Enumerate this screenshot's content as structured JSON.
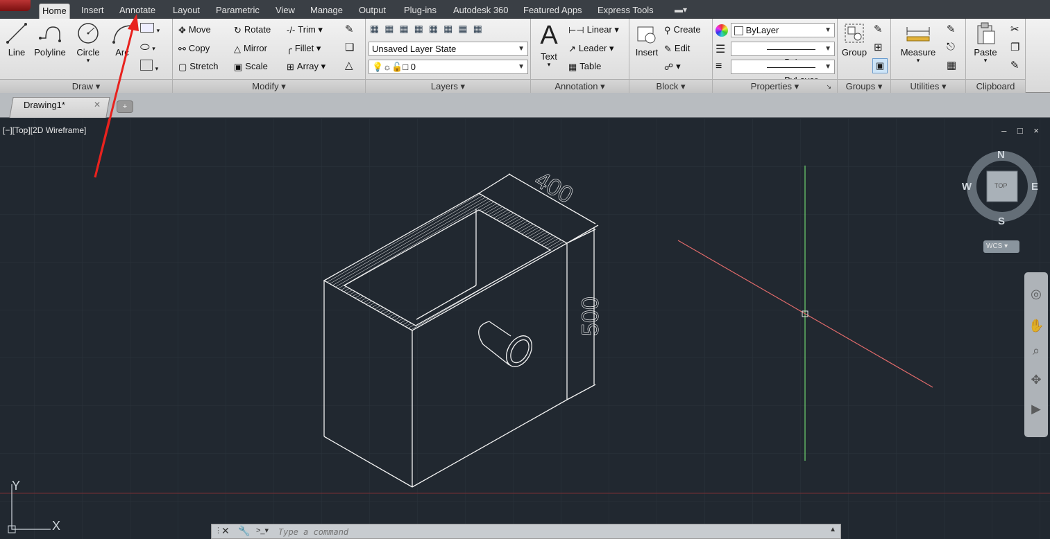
{
  "ribbon_tabs": [
    "Home",
    "Insert",
    "Annotate",
    "Layout",
    "Parametric",
    "View",
    "Manage",
    "Output",
    "Plug-ins",
    "Autodesk 360",
    "Featured Apps",
    "Express Tools"
  ],
  "active_tab": "Home",
  "draw": {
    "title": "Draw",
    "line": "Line",
    "polyline": "Polyline",
    "circle": "Circle",
    "arc": "Arc"
  },
  "modify": {
    "title": "Modify",
    "move": "Move",
    "rotate": "Rotate",
    "trim": "Trim",
    "copy": "Copy",
    "mirror": "Mirror",
    "fillet": "Fillet",
    "stretch": "Stretch",
    "scale": "Scale",
    "array": "Array"
  },
  "layers": {
    "title": "Layers",
    "layer_state": "Unsaved Layer State",
    "current_layer": "0"
  },
  "annotation": {
    "title": "Annotation",
    "text": "Text",
    "linear": "Linear",
    "leader": "Leader",
    "table": "Table"
  },
  "block": {
    "title": "Block",
    "insert": "Insert",
    "create": "Create",
    "edit": "Edit"
  },
  "properties": {
    "title": "Properties",
    "color": "ByLayer",
    "linetype": "ByLayer",
    "lineweight": "ByLayer"
  },
  "groups": {
    "title": "Groups",
    "group": "Group"
  },
  "utilities": {
    "title": "Utilities",
    "measure": "Measure"
  },
  "clipboard": {
    "title": "Clipboard",
    "paste": "Paste"
  },
  "document_tab": "Drawing1*",
  "viewport_label": "[−][Top][2D Wireframe]",
  "viewport_controls": "– □ ×",
  "viewcube": {
    "n": "N",
    "s": "S",
    "e": "E",
    "w": "W",
    "face": "TOP",
    "wcs": "WCS"
  },
  "drawing": {
    "dim_width": "400",
    "dim_height": "500"
  },
  "ucs": {
    "x": "X",
    "y": "Y"
  },
  "command": {
    "placeholder": "Type a command"
  },
  "colors": {
    "accent_red": "#e8221e",
    "axis_green": "#6fd66f",
    "axis_red": "#e06a6a",
    "viewport_bg": "#212830"
  }
}
